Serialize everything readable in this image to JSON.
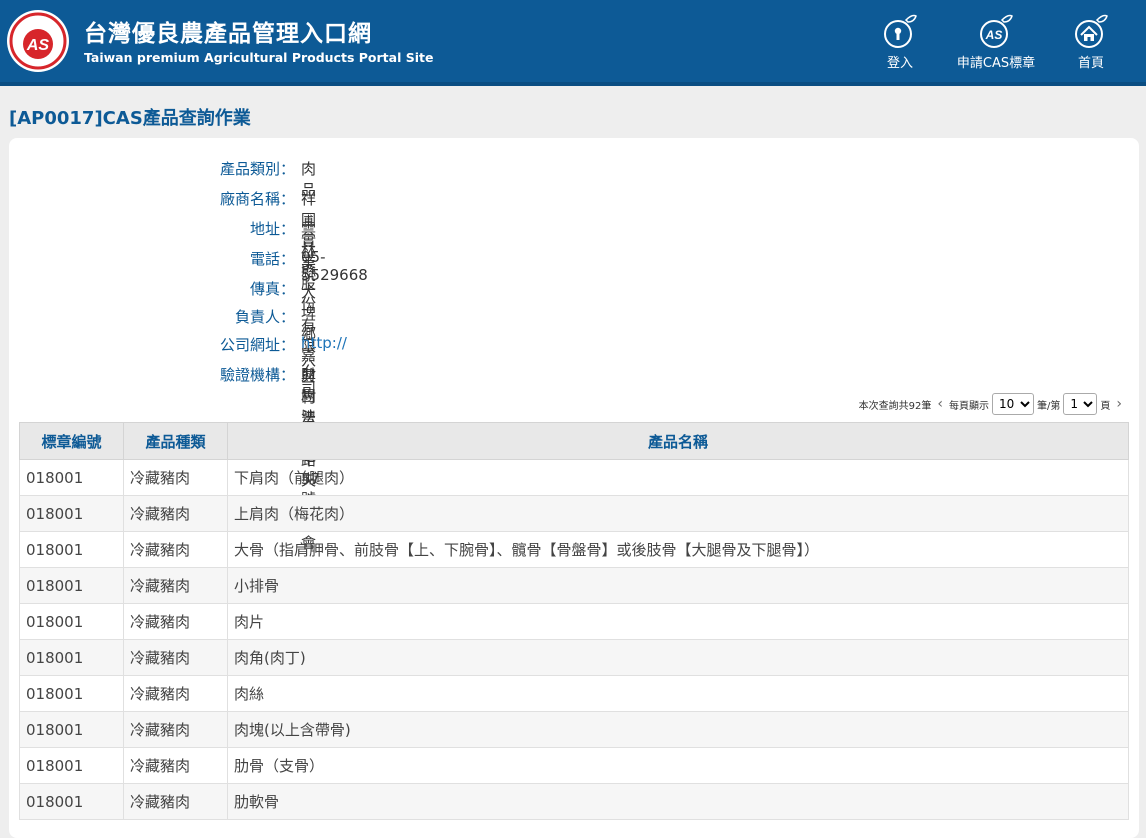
{
  "header": {
    "title": "台灣優良農產品管理入口網",
    "subtitle": "Taiwan premium Agricultural Products Portal Site",
    "logo_text": "AS",
    "nav": [
      {
        "label": "登入",
        "icon": "keyhole-icon"
      },
      {
        "label": "申請CAS標章",
        "icon": "cas-badge-icon"
      },
      {
        "label": "首頁",
        "icon": "home-icon"
      }
    ]
  },
  "page": {
    "title": "[AP0017]CAS產品查詢作業"
  },
  "info": {
    "category_label": "產品類別：",
    "category": "肉品",
    "company_label": "廠商名稱：",
    "company": "祥圃實業股份有限公司",
    "address_label": "地址：",
    "address": "雲林縣大埤鄉嘉興村豐田路57號",
    "phone_label": "電話：",
    "phone": "05-5529668",
    "fax_label": "傳真：",
    "fax": "",
    "owner_label": "負責人：",
    "owner": "",
    "website_label": "公司網址：",
    "website": "http://",
    "certifier_label": "驗證機構：",
    "certifier": "財團法人中央畜產會"
  },
  "pager": {
    "total_text": "本次查詢共92筆",
    "per_page_label": "每頁顯示",
    "per_page": "10",
    "unit_label": "筆/第",
    "page": "1",
    "page_suffix": "頁"
  },
  "table": {
    "headers": [
      "標章編號",
      "產品種類",
      "產品名稱"
    ],
    "rows": [
      [
        "018001",
        "冷藏豬肉",
        "下肩肉（前腿肉）"
      ],
      [
        "018001",
        "冷藏豬肉",
        "上肩肉（梅花肉）"
      ],
      [
        "018001",
        "冷藏豬肉",
        "大骨（指肩胛骨、前肢骨【上、下腕骨】、髖骨【骨盤骨】或後肢骨【大腿骨及下腿骨】）"
      ],
      [
        "018001",
        "冷藏豬肉",
        "小排骨"
      ],
      [
        "018001",
        "冷藏豬肉",
        "肉片"
      ],
      [
        "018001",
        "冷藏豬肉",
        "肉角(肉丁)"
      ],
      [
        "018001",
        "冷藏豬肉",
        "肉絲"
      ],
      [
        "018001",
        "冷藏豬肉",
        "肉塊(以上含帶骨)"
      ],
      [
        "018001",
        "冷藏豬肉",
        "肋骨（支骨）"
      ],
      [
        "018001",
        "冷藏豬肉",
        "肋軟骨"
      ]
    ]
  },
  "colors": {
    "header_bg": "#0d5a96",
    "label": "#0d5a96",
    "logo_red": "#d7262b"
  }
}
